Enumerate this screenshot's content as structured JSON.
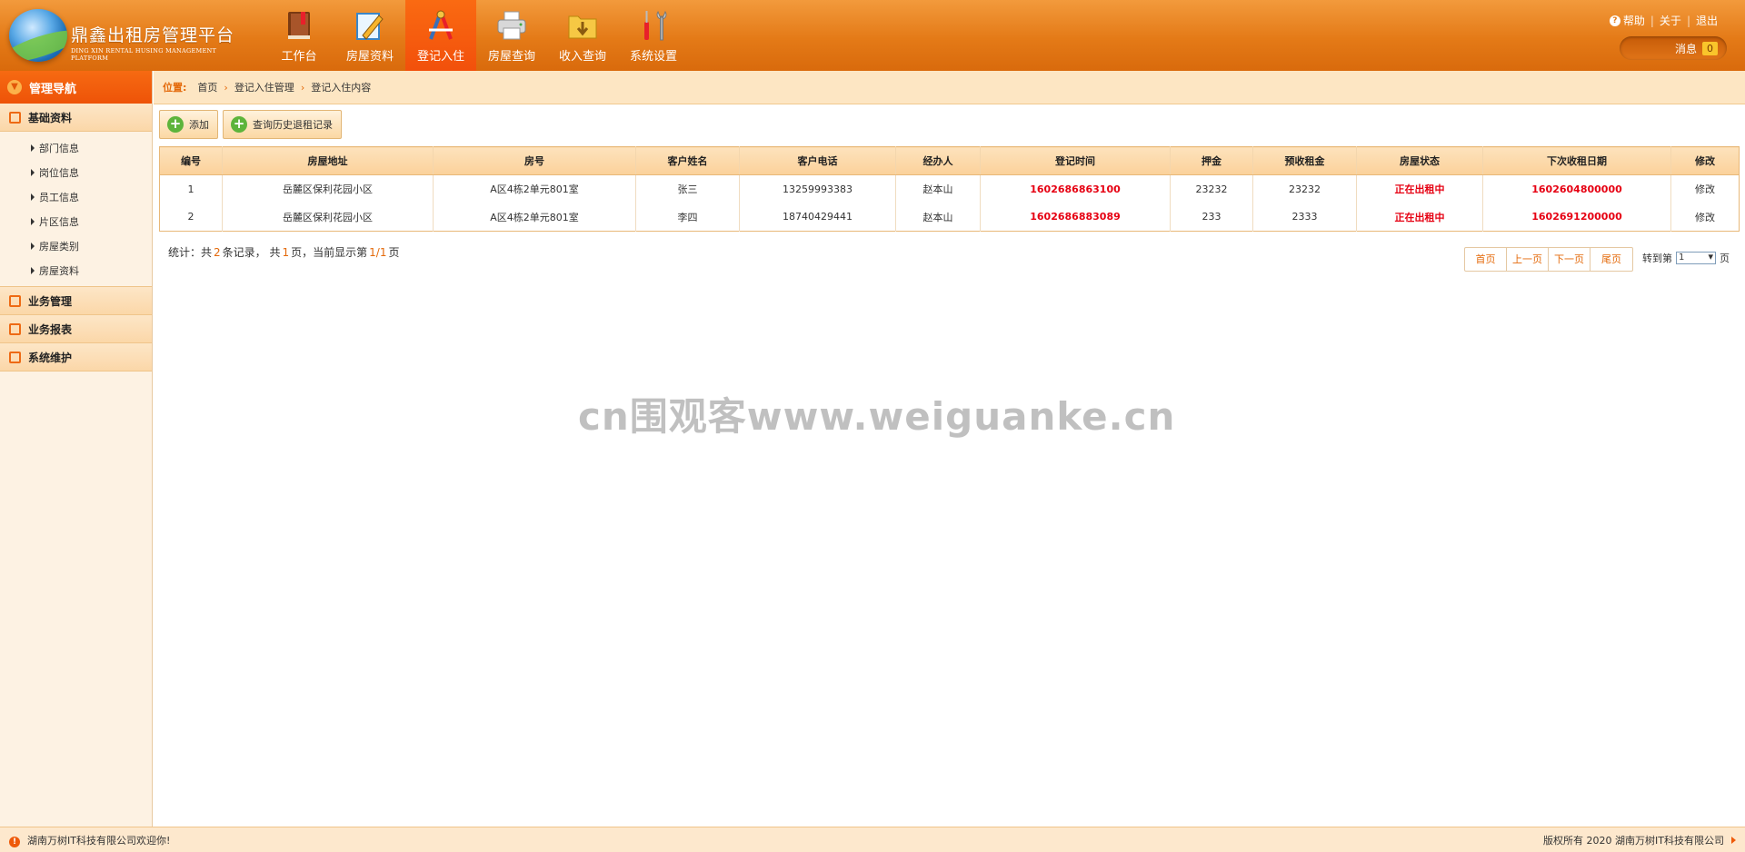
{
  "header": {
    "logo_title": "鼎鑫出租房管理平台",
    "logo_sub": "DING XIN RENTAL HUSING MANAGEMENT PLATFORM",
    "nav": [
      {
        "label": "工作台",
        "icon": "book-icon"
      },
      {
        "label": "房屋资料",
        "icon": "pencil-note-icon"
      },
      {
        "label": "登记入住",
        "icon": "drafting-tools-icon"
      },
      {
        "label": "房屋查询",
        "icon": "printer-icon"
      },
      {
        "label": "收入查询",
        "icon": "download-folder-icon"
      },
      {
        "label": "系统设置",
        "icon": "tools-icon"
      }
    ],
    "active_nav": "登记入住",
    "links": {
      "help": "帮助",
      "about": "关于",
      "logout": "退出"
    },
    "message_label": "消息",
    "message_count": "0"
  },
  "sidebar": {
    "title": "管理导航",
    "groups": [
      {
        "label": "基础资料",
        "items": [
          "部门信息",
          "岗位信息",
          "员工信息",
          "片区信息",
          "房屋类别",
          "房屋资料"
        ]
      },
      {
        "label": "业务管理"
      },
      {
        "label": "业务报表"
      },
      {
        "label": "系统维护"
      }
    ]
  },
  "breadcrumb": {
    "label": "位置:",
    "items": [
      "首页",
      "登记入住管理",
      "登记入住内容"
    ]
  },
  "toolbar": {
    "add": "添加",
    "history": "查询历史退租记录"
  },
  "table": {
    "columns": [
      "编号",
      "房屋地址",
      "房号",
      "客户姓名",
      "客户电话",
      "经办人",
      "登记时间",
      "押金",
      "预收租金",
      "房屋状态",
      "下次收租日期",
      "修改"
    ],
    "rows": [
      [
        "1",
        "岳麓区保利花园小区",
        "A区4栋2单元801室",
        "张三",
        "13259993383",
        "赵本山",
        "1602686863100",
        "23232",
        "23232",
        "正在出租中",
        "1602604800000",
        "修改"
      ],
      [
        "2",
        "岳麓区保利花园小区",
        "A区4栋2单元801室",
        "李四",
        "18740429441",
        "赵本山",
        "1602686883089",
        "233",
        "2333",
        "正在出租中",
        "1602691200000",
        "修改"
      ]
    ]
  },
  "stats": {
    "p1": "统计：共",
    "total": "2",
    "p2": "条记录，  共",
    "pages": "1",
    "p3": "页，当前显示第",
    "current": "1/1",
    "p4": "页"
  },
  "pager": {
    "first": "首页",
    "prev": "上一页",
    "next": "下一页",
    "last": "尾页",
    "goto_prefix": "转到第",
    "goto_value": "1",
    "goto_suffix": "页"
  },
  "watermark": "cn围观客www.weiguanke.cn",
  "footer": {
    "left": "湖南万树IT科技有限公司欢迎你!",
    "right": "版权所有 2020 湖南万树IT科技有限公司"
  },
  "colors": {
    "brand_orange": "#e47a17",
    "active_tab": "#f2500b",
    "status_red": "#e60012",
    "link_orange": "#e46a0b"
  }
}
